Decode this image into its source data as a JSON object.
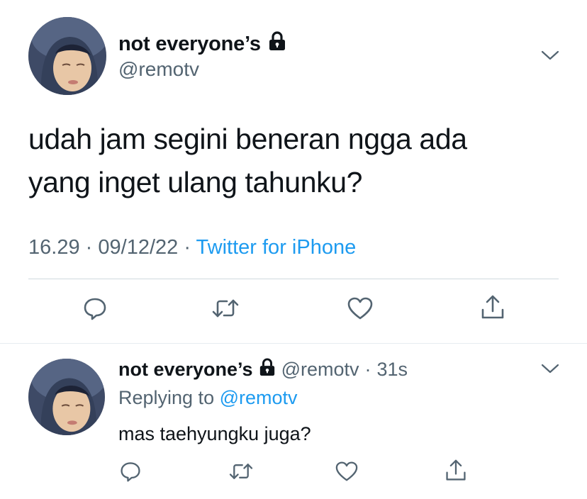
{
  "tweet": {
    "display_name": "not everyone’s",
    "handle": "@remotv",
    "text_line1": "udah jam segini beneran ngga ada",
    "text_line2": "yang inget ulang tahunku?",
    "time": "16.29",
    "date": "09/12/22",
    "separator": "·",
    "source": "Twitter for iPhone"
  },
  "reply": {
    "display_name": "not everyone’s",
    "handle": "@remotv",
    "separator": "·",
    "age": "31s",
    "replying_prefix": "Replying to",
    "replying_handle": "@remotv",
    "text": "mas taehyungku juga?"
  },
  "icons": {
    "lock": "lock-icon",
    "chevron": "chevron-down-icon",
    "reply": "reply-icon",
    "retweet": "retweet-icon",
    "like": "heart-icon",
    "share": "share-icon"
  },
  "colors": {
    "text": "#0f1419",
    "secondary": "#536471",
    "link": "#1d9bf0",
    "divider": "#cfd9de"
  }
}
